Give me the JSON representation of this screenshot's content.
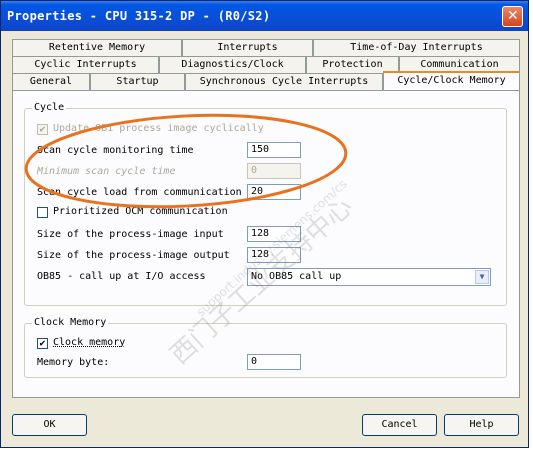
{
  "window": {
    "title": "Properties - CPU 315-2 DP - (R0/S2)",
    "close_glyph": "✕"
  },
  "tabs": {
    "row1": [
      "Retentive Memory",
      "Interrupts",
      "Time-of-Day Interrupts"
    ],
    "row2": [
      "Cyclic Interrupts",
      "Diagnostics/Clock",
      "Protection",
      "Communication"
    ],
    "row3": [
      "General",
      "Startup",
      "Synchronous Cycle Interrupts",
      "Cycle/Clock Memory"
    ],
    "active": "Cycle/Clock Memory"
  },
  "cycle": {
    "group_title": "Cycle",
    "update_oб_label": "Update OB1 process image cyclically",
    "update_checked": true,
    "scan_monitoring_label": "Scan cycle monitoring time",
    "scan_monitoring_value": "150",
    "min_scan_label": "Minimum scan cycle time",
    "min_scan_value": "0",
    "scan_load_label": "Scan cycle load from communication",
    "scan_load_value": "20",
    "prioritized_label": "Prioritized OCM communication",
    "prioritized_checked": false,
    "pi_input_label": "Size of the process-image input",
    "pi_input_value": "128",
    "pi_output_label": "Size of the process-image output",
    "pi_output_value": "128",
    "ob85_label": "OB85 - call up at I/O access",
    "ob85_value": "No OB85 call up"
  },
  "clock": {
    "group_title": "Clock Memory",
    "clock_memory_label": "Clock memory",
    "clock_memory_checked": true,
    "memory_byte_label": "Memory byte:",
    "memory_byte_value": "0"
  },
  "buttons": {
    "ok": "OK",
    "cancel": "Cancel",
    "help": "Help"
  },
  "watermark": {
    "cn": "西门子工业支持中心",
    "url": "support.industry.siemens.com/cs"
  },
  "colors": {
    "titlebar": "#0a4fd8",
    "highlight_ellipse": "#e8731f",
    "active_tab": "#e68b2c"
  }
}
